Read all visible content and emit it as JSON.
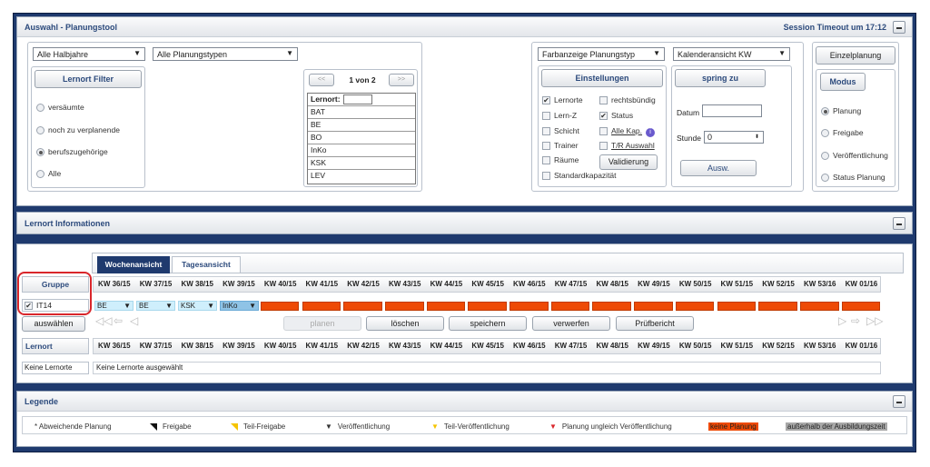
{
  "top": {
    "title": "Auswahl - Planungstool",
    "session": "Session Timeout um 17:12",
    "halbjahr": "Alle Halbjahre",
    "planungstyp": "Alle Planungstypen",
    "lernort_filter": "Lernort Filter",
    "filters": [
      "versäumte",
      "noch zu verplanende",
      "berufszugehörige",
      "Alle"
    ],
    "filter_selected": 2,
    "pager": {
      "prev": "<<",
      "label": "1 von 2",
      "next": ">>"
    },
    "lernort_label": "Lernort:",
    "lernort_items": [
      "BAT",
      "BE",
      "BO",
      "InKo",
      "KSK",
      "LEV"
    ],
    "farbanzeige": "Farbanzeige Planungstyp",
    "einstellungen": "Einstellungen",
    "settings_left": [
      {
        "label": "Lernorte",
        "checked": true
      },
      {
        "label": "Lern-Z",
        "checked": false
      },
      {
        "label": "Schicht",
        "checked": false
      },
      {
        "label": "Trainer",
        "checked": false
      },
      {
        "label": "Räume",
        "checked": false
      },
      {
        "label": "Standardkapazität",
        "checked": false
      }
    ],
    "settings_right": [
      {
        "label": "rechtsbündig",
        "checked": false
      },
      {
        "label": "Status",
        "checked": true
      },
      {
        "label": "Alle Kap.",
        "checked": false
      },
      {
        "label": "T/R Auswahl",
        "checked": false
      }
    ],
    "validierung": "Validierung",
    "kalender": "Kalenderansicht KW",
    "spring_zu": "spring zu",
    "datum_label": "Datum",
    "stunde_label": "Stunde",
    "stunde_value": "0",
    "ausw": "Ausw.",
    "einzelplanung": "Einzelplanung",
    "modus": "Modus",
    "modes": [
      "Planung",
      "Freigabe",
      "Veröffentlichung",
      "Status Planung"
    ],
    "mode_selected": 0
  },
  "info": {
    "title": "Lernort Informationen"
  },
  "plan": {
    "tabs": [
      "Wochenansicht",
      "Tagesansicht"
    ],
    "gruppe": "Gruppe",
    "group_row": "IT14",
    "auswaehlen": "auswählen",
    "weeks": [
      "KW 36/15",
      "KW 37/15",
      "KW 38/15",
      "KW 39/15",
      "KW 40/15",
      "KW 41/15",
      "KW 42/15",
      "KW 43/15",
      "KW 44/15",
      "KW 45/15",
      "KW 46/15",
      "KW 47/15",
      "KW 48/15",
      "KW 49/15",
      "KW 50/15",
      "KW 51/15",
      "KW 52/15",
      "KW 53/16",
      "KW 01/16"
    ],
    "cells": [
      "BE",
      "BE",
      "KSK",
      "InKo"
    ],
    "actions": [
      "planen",
      "löschen",
      "speichern",
      "verwerfen",
      "Prüfbericht"
    ],
    "lernort": "Lernort",
    "keine_lernorte": "Keine Lernorte",
    "keine_ausgewaehlt": "Keine Lernorte ausgewählt"
  },
  "legende": {
    "title": "Legende",
    "items": [
      "* Abweichende Planung",
      "Freigabe",
      "Teil-Freigabe",
      "Veröffentlichung",
      "Teil-Veröffentlichung",
      "Planung ungleich Veröffentlichung",
      "keine Planung",
      "außerhalb der Ausbildungszeit"
    ]
  },
  "colors": {
    "accent": "#2c4a7c",
    "frame": "#1f3a6e",
    "no_plan": "#ee4a05",
    "highlight": "#d9262b"
  }
}
